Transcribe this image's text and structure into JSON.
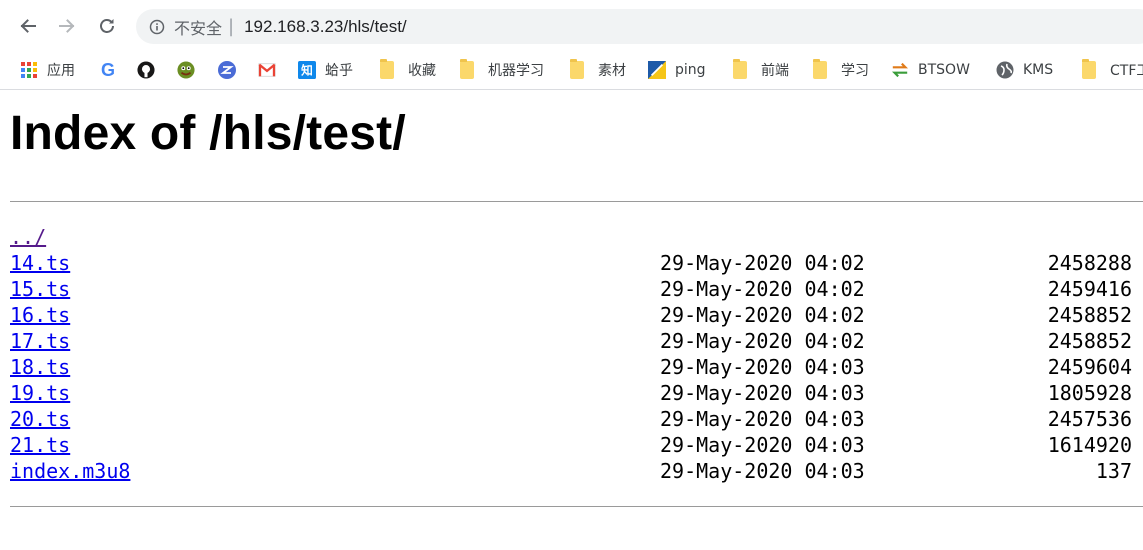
{
  "browser": {
    "security_label": "不安全",
    "url": "192.168.3.23/hls/test/"
  },
  "bookmarks": [
    {
      "label": "应用",
      "icon": "apps-grid-icon"
    },
    {
      "label": "",
      "icon": "google-icon"
    },
    {
      "label": "",
      "icon": "github-icon"
    },
    {
      "label": "",
      "icon": "frog-avatar-icon"
    },
    {
      "label": "",
      "icon": "blue-circle-z-icon"
    },
    {
      "label": "",
      "icon": "gmail-icon"
    },
    {
      "label": "蛤乎",
      "icon": "zhihu-icon"
    },
    {
      "label": "收藏",
      "icon": "folder-icon"
    },
    {
      "label": "机器学习",
      "icon": "folder-icon"
    },
    {
      "label": "素材",
      "icon": "folder-icon"
    },
    {
      "label": "ping",
      "icon": "ping-icon"
    },
    {
      "label": "前端",
      "icon": "folder-icon"
    },
    {
      "label": "学习",
      "icon": "folder-icon"
    },
    {
      "label": "BTSOW",
      "icon": "arrows-exchange-icon"
    },
    {
      "label": "KMS",
      "icon": "globe-icon"
    },
    {
      "label": "CTF工",
      "icon": "folder-icon"
    }
  ],
  "page": {
    "title": "Index of /hls/test/",
    "parent_link": "../",
    "files": [
      {
        "name": "14.ts",
        "date": "29-May-2020 04:02",
        "size": "2458288"
      },
      {
        "name": "15.ts",
        "date": "29-May-2020 04:02",
        "size": "2459416"
      },
      {
        "name": "16.ts",
        "date": "29-May-2020 04:02",
        "size": "2458852"
      },
      {
        "name": "17.ts",
        "date": "29-May-2020 04:02",
        "size": "2458852"
      },
      {
        "name": "18.ts",
        "date": "29-May-2020 04:03",
        "size": "2459604"
      },
      {
        "name": "19.ts",
        "date": "29-May-2020 04:03",
        "size": "1805928"
      },
      {
        "name": "20.ts",
        "date": "29-May-2020 04:03",
        "size": "2457536"
      },
      {
        "name": "21.ts",
        "date": "29-May-2020 04:03",
        "size": "1614920"
      },
      {
        "name": "index.m3u8",
        "date": "29-May-2020 04:03",
        "size": "137"
      }
    ]
  }
}
